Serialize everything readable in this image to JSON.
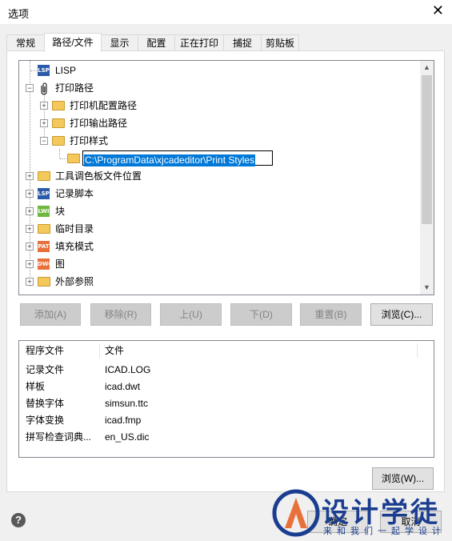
{
  "window": {
    "title": "选项",
    "close_glyph": "✕"
  },
  "tabs": [
    "常规",
    "路径/文件",
    "显示",
    "配置",
    "正在打印",
    "捕捉",
    "剪贴板"
  ],
  "tree": {
    "items": [
      {
        "label": "LISP",
        "icon": "lsp-icon",
        "badge": "LSP",
        "color": "#2a5aa8"
      },
      {
        "label": "打印路径",
        "icon": "paperclip-icon"
      },
      {
        "label": "打印机配置路径",
        "icon": "folder-icon"
      },
      {
        "label": "打印输出路径",
        "icon": "folder-icon"
      },
      {
        "label": "打印样式",
        "icon": "folder-icon"
      },
      {
        "label": "C:\\ProgramData\\xjcadeditor\\Print Styles",
        "icon": "folder-icon",
        "editing": true
      },
      {
        "label": "工具调色板文件位置",
        "icon": "folder-icon"
      },
      {
        "label": "记录脚本",
        "icon": "lsp-icon",
        "badge": "LSP",
        "color": "#2a5aa8"
      },
      {
        "label": "块",
        "icon": "lwi-icon",
        "badge": "LWI",
        "color": "#6fb83f"
      },
      {
        "label": "临时目录",
        "icon": "folder-icon"
      },
      {
        "label": "填充模式",
        "icon": "pat-icon",
        "badge": "PAT",
        "color": "#e8703a"
      },
      {
        "label": "图",
        "icon": "dwg-icon",
        "badge": "DWG",
        "color": "#e8703a"
      },
      {
        "label": "外部参照",
        "icon": "folder-icon"
      }
    ]
  },
  "buttons": {
    "add": "添加(A)",
    "remove": "移除(R)",
    "up": "上(U)",
    "down": "下(D)",
    "reset": "重置(B)",
    "browse": "浏览(C)...",
    "browse2": "浏览(W)...",
    "ok": "确定",
    "cancel": "取消"
  },
  "list": {
    "headers": [
      "程序文件",
      "文件"
    ],
    "rows": [
      [
        "记录文件",
        "ICAD.LOG"
      ],
      [
        "样板",
        "icad.dwt"
      ],
      [
        "替换字体",
        "simsun.ttc"
      ],
      [
        "字体变换",
        "icad.fmp"
      ],
      [
        "拼写检查词典...",
        "en_US.dic"
      ]
    ]
  },
  "help_glyph": "?",
  "watermark": {
    "title": "设计学徒",
    "subtitle": "来和我们一起学设计"
  }
}
